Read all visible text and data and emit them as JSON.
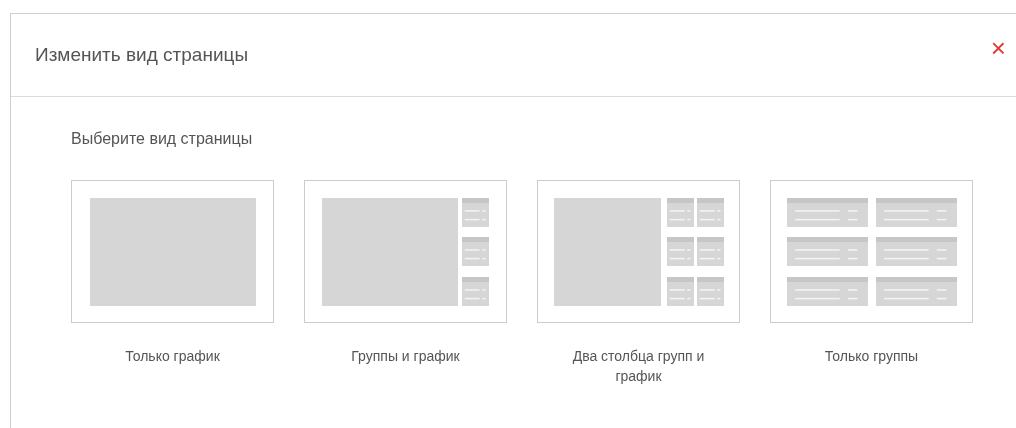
{
  "dialog": {
    "title": "Изменить вид страницы",
    "close": "×",
    "prompt": "Выберите вид страницы",
    "layouts": [
      {
        "kind": "chart",
        "label": "Только график"
      },
      {
        "kind": "groups_chart",
        "label": "Группы и график"
      },
      {
        "kind": "two_columns",
        "label": "Два столбца групп и график"
      },
      {
        "kind": "groups",
        "label": "Только группы"
      }
    ]
  }
}
